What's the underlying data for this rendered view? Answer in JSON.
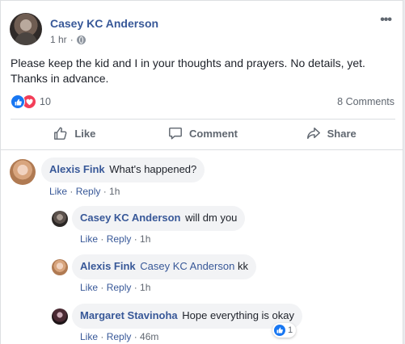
{
  "post": {
    "author": "Casey KC Anderson",
    "time": "1 hr",
    "meta_sep": "·",
    "more_label": "•••",
    "text": "Please keep the kid and I in your thoughts and prayers. No details, yet. Thanks in advance.",
    "reaction_count": "10",
    "comments_count": "8 Comments"
  },
  "actions": {
    "like": "Like",
    "comment": "Comment",
    "share": "Share"
  },
  "comments": [
    {
      "name": "Alexis Fink",
      "mention": "",
      "text": " What's happened?",
      "like": "Like",
      "reply": "Reply",
      "time": "1h"
    },
    {
      "name": "Casey KC Anderson",
      "mention": "",
      "text": " will dm you",
      "like": "Like",
      "reply": "Reply",
      "time": "1h"
    },
    {
      "name": "Alexis Fink",
      "mention": " Casey KC Anderson",
      "text": " kk",
      "like": "Like",
      "reply": "Reply",
      "time": "1h"
    },
    {
      "name": "Margaret Stavinoha",
      "mention": "",
      "text": " Hope everything is okay",
      "like": "Like",
      "reply": "Reply",
      "time": "46m",
      "reactions": "1"
    }
  ],
  "colors": {
    "link": "#385898",
    "like_blue": "#1877f2",
    "love_red": "#f33e58"
  },
  "icons": [
    "globe-icon",
    "more-options-icon",
    "like-reaction-icon",
    "love-reaction-icon",
    "like-thumb-icon",
    "comment-bubble-icon",
    "share-arrow-icon"
  ]
}
